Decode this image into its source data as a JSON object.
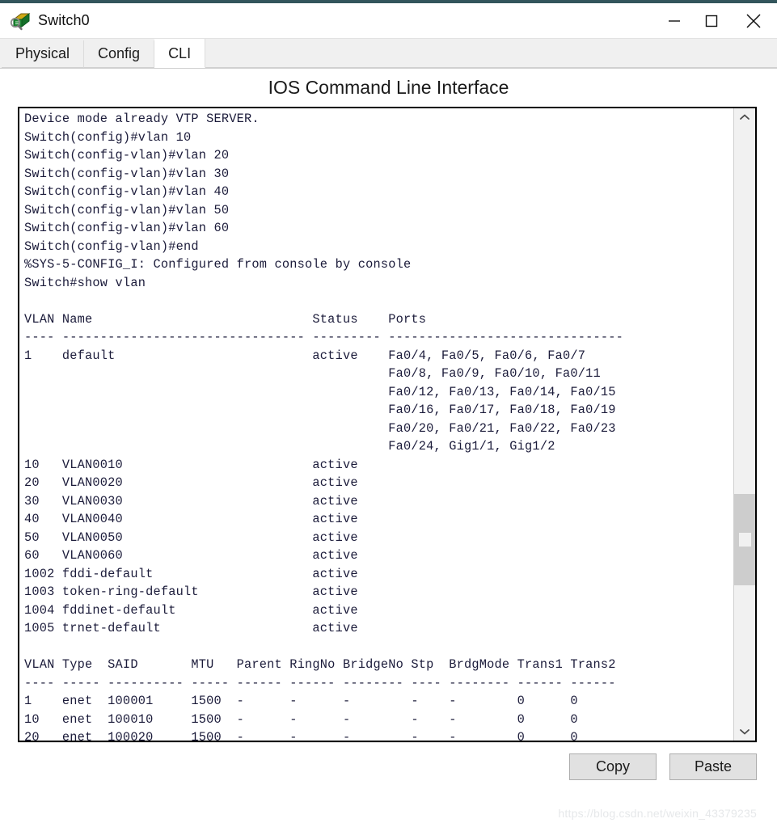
{
  "window": {
    "title": "Switch0",
    "icon": "switch-device-icon",
    "controls": {
      "minimize": "minimize-icon",
      "maximize": "maximize-icon",
      "close": "close-icon"
    },
    "accent_color": "#33555c"
  },
  "tabs": [
    {
      "label": "Physical",
      "active": false
    },
    {
      "label": "Config",
      "active": false
    },
    {
      "label": "CLI",
      "active": true
    }
  ],
  "panel": {
    "title": "IOS Command Line Interface"
  },
  "terminal": {
    "lines": [
      "Device mode already VTP SERVER.",
      "Switch(config)#vlan 10",
      "Switch(config-vlan)#vlan 20",
      "Switch(config-vlan)#vlan 30",
      "Switch(config-vlan)#vlan 40",
      "Switch(config-vlan)#vlan 50",
      "Switch(config-vlan)#vlan 60",
      "Switch(config-vlan)#end",
      "%SYS-5-CONFIG_I: Configured from console by console",
      "Switch#show vlan",
      "",
      "VLAN Name                             Status    Ports",
      "---- -------------------------------- --------- -------------------------------",
      "1    default                          active    Fa0/4, Fa0/5, Fa0/6, Fa0/7",
      "                                                Fa0/8, Fa0/9, Fa0/10, Fa0/11",
      "                                                Fa0/12, Fa0/13, Fa0/14, Fa0/15",
      "                                                Fa0/16, Fa0/17, Fa0/18, Fa0/19",
      "                                                Fa0/20, Fa0/21, Fa0/22, Fa0/23",
      "                                                Fa0/24, Gig1/1, Gig1/2",
      "10   VLAN0010                         active",
      "20   VLAN0020                         active",
      "30   VLAN0030                         active",
      "40   VLAN0040                         active",
      "50   VLAN0050                         active",
      "60   VLAN0060                         active",
      "1002 fddi-default                     active",
      "1003 token-ring-default               active",
      "1004 fddinet-default                  active",
      "1005 trnet-default                    active",
      "",
      "VLAN Type  SAID       MTU   Parent RingNo BridgeNo Stp  BrdgMode Trans1 Trans2",
      "---- ----- ---------- ----- ------ ------ -------- ---- -------- ------ ------",
      "1    enet  100001     1500  -      -      -        -    -        0      0",
      "10   enet  100010     1500  -      -      -        -    -        0      0",
      "20   enet  100020     1500  -      -      -        -    -        0      0"
    ],
    "vlan_table": {
      "columns": [
        "VLAN",
        "Name",
        "Status",
        "Ports"
      ],
      "rows": [
        {
          "vlan": "1",
          "name": "default",
          "status": "active",
          "ports": [
            "Fa0/4, Fa0/5, Fa0/6, Fa0/7",
            "Fa0/8, Fa0/9, Fa0/10, Fa0/11",
            "Fa0/12, Fa0/13, Fa0/14, Fa0/15",
            "Fa0/16, Fa0/17, Fa0/18, Fa0/19",
            "Fa0/20, Fa0/21, Fa0/22, Fa0/23",
            "Fa0/24, Gig1/1, Gig1/2"
          ]
        },
        {
          "vlan": "10",
          "name": "VLAN0010",
          "status": "active",
          "ports": []
        },
        {
          "vlan": "20",
          "name": "VLAN0020",
          "status": "active",
          "ports": []
        },
        {
          "vlan": "30",
          "name": "VLAN0030",
          "status": "active",
          "ports": []
        },
        {
          "vlan": "40",
          "name": "VLAN0040",
          "status": "active",
          "ports": []
        },
        {
          "vlan": "50",
          "name": "VLAN0050",
          "status": "active",
          "ports": []
        },
        {
          "vlan": "60",
          "name": "VLAN0060",
          "status": "active",
          "ports": []
        },
        {
          "vlan": "1002",
          "name": "fddi-default",
          "status": "active",
          "ports": []
        },
        {
          "vlan": "1003",
          "name": "token-ring-default",
          "status": "active",
          "ports": []
        },
        {
          "vlan": "1004",
          "name": "fddinet-default",
          "status": "active",
          "ports": []
        },
        {
          "vlan": "1005",
          "name": "trnet-default",
          "status": "active",
          "ports": []
        }
      ]
    },
    "said_table": {
      "columns": [
        "VLAN",
        "Type",
        "SAID",
        "MTU",
        "Parent",
        "RingNo",
        "BridgeNo",
        "Stp",
        "BrdgMode",
        "Trans1",
        "Trans2"
      ],
      "rows": [
        [
          "1",
          "enet",
          "100001",
          "1500",
          "-",
          "-",
          "-",
          "-",
          "-",
          "0",
          "0"
        ],
        [
          "10",
          "enet",
          "100010",
          "1500",
          "-",
          "-",
          "-",
          "-",
          "-",
          "0",
          "0"
        ],
        [
          "20",
          "enet",
          "100020",
          "1500",
          "-",
          "-",
          "-",
          "-",
          "-",
          "0",
          "0"
        ]
      ]
    }
  },
  "scrollbar": {
    "up_icon": "chevron-up-icon",
    "down_icon": "chevron-down-icon"
  },
  "footer": {
    "copy_label": "Copy",
    "paste_label": "Paste",
    "watermark": "https://blog.csdn.net/weixin_43379235"
  }
}
